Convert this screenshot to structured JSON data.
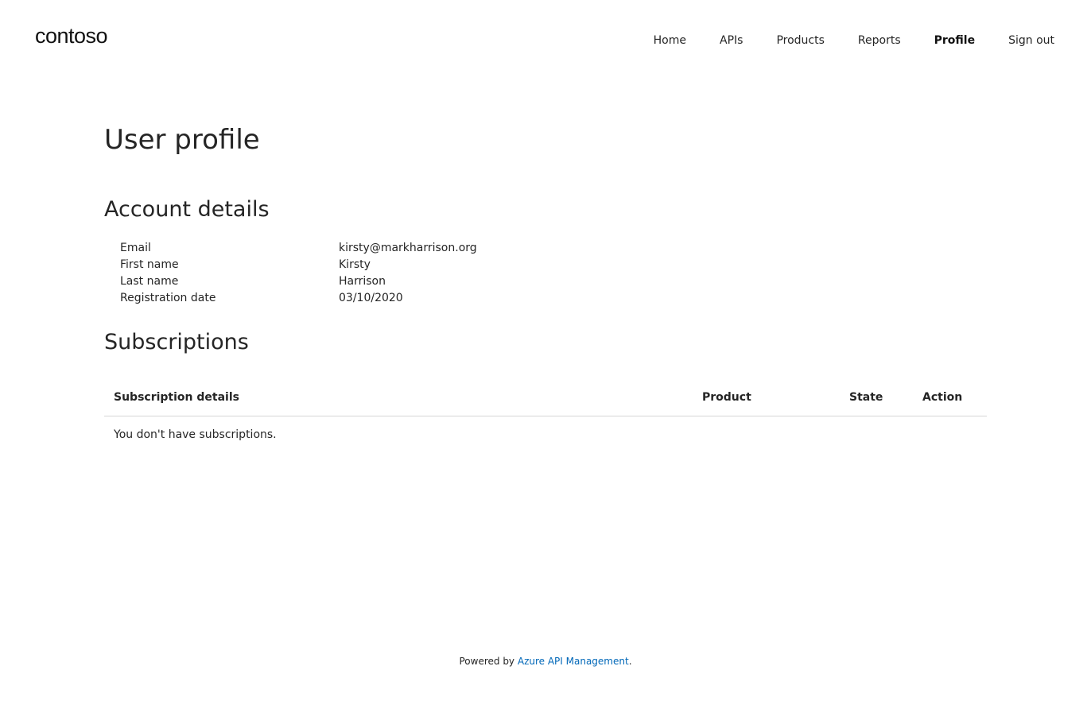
{
  "header": {
    "logo": "contoso",
    "nav": [
      "Home",
      "APIs",
      "Products",
      "Reports",
      "Profile",
      "Sign out"
    ]
  },
  "main": {
    "title": "User profile",
    "account": {
      "title": "Account details",
      "fields": [
        {
          "label": "Email",
          "value": "kirsty@markharrison.org"
        },
        {
          "label": "First name",
          "value": "Kirsty"
        },
        {
          "label": "Last name",
          "value": "Harrison"
        },
        {
          "label": "Registration date",
          "value": "03/10/2020"
        }
      ]
    },
    "subscriptions": {
      "title": "Subscriptions",
      "columns": [
        "Subscription details",
        "Product",
        "State",
        "Action"
      ],
      "empty_text": "You don't have subscriptions."
    }
  },
  "footer": {
    "prefix": "Powered by ",
    "link": "Azure API Management",
    "suffix": "."
  }
}
